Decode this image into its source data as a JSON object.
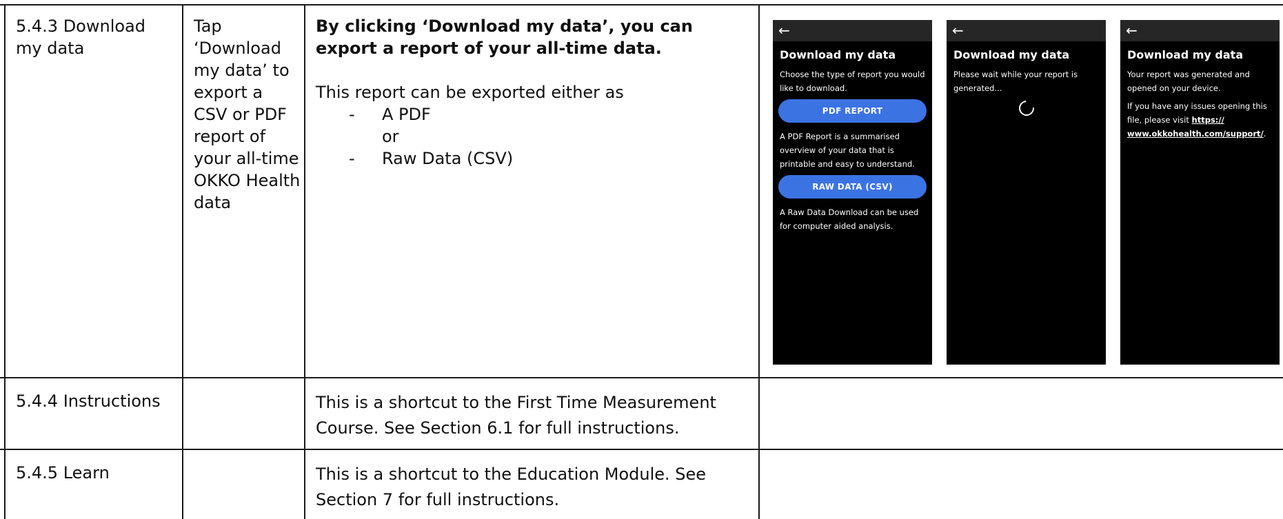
{
  "rows": [
    {
      "section": "5.4.3 Download my data",
      "action": "Tap ‘Download my data’ to export a CSV or PDF report of your all-time OKKO Health data",
      "description_bold": "By clicking ‘Download my data’, you can export a report of your all-time data.",
      "description_intro": "This report can be exported either as",
      "description_options": [
        "A PDF",
        "Raw Data (CSV)"
      ],
      "description_or": "or",
      "dash": "-"
    },
    {
      "section": "5.4.4 Instructions",
      "action": "",
      "description": "This is a shortcut to the First Time Measurement Course. See Section 6.1 for full instructions."
    },
    {
      "section": "5.4.5 Learn",
      "action": "",
      "description": "This is a shortcut to the Education Module. See Section 7 for full instructions."
    }
  ],
  "screens": [
    {
      "back_icon": "arrow-left-icon",
      "back_glyph": "←",
      "title": "Download my data",
      "text1": "Choose the type of report you would like to download.",
      "button1": "PDF REPORT",
      "text2": "A PDF Report is a summarised overview of your data that is printable and easy to understand.",
      "button2": "RAW DATA (CSV)",
      "text3": "A Raw Data Download can be used for computer aided analysis."
    },
    {
      "back_icon": "arrow-left-icon",
      "back_glyph": "←",
      "title": "Download my data",
      "text1": "Please wait while your report is generated...",
      "spinner_icon": "loading-spinner-icon"
    },
    {
      "back_icon": "arrow-left-icon",
      "back_glyph": "←",
      "title": "Download my data",
      "text1": "Your report was generated and opened on your device.",
      "text2_prefix": "If you have any issues opening this file, please visit ",
      "link": "https:// www.okkohealth.com/support/",
      "text2_suffix": "."
    }
  ],
  "colors": {
    "button_blue": "#3b73e3",
    "phone_bg": "#000000",
    "phone_topbar": "#262626",
    "grid_line": "#1a1a1a"
  }
}
